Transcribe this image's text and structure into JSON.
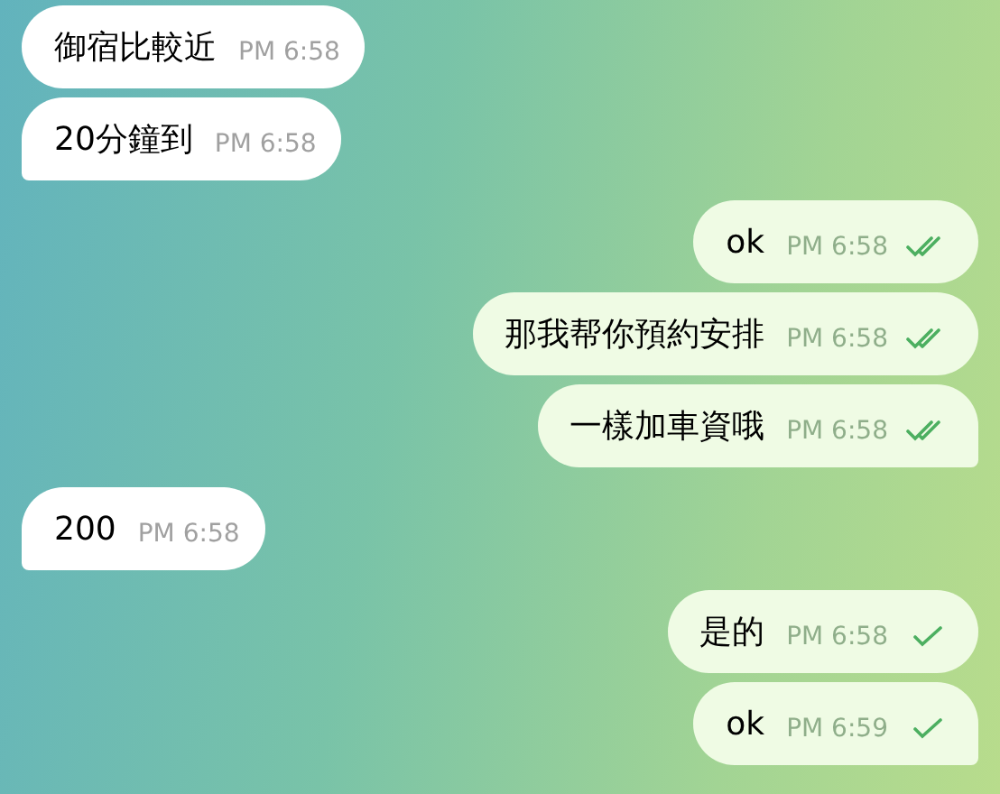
{
  "messages": [
    {
      "kind": "incoming",
      "text": "御宿比較近",
      "time": "PM 6:58"
    },
    {
      "kind": "incoming",
      "text": "20分鐘到",
      "time": "PM 6:58"
    },
    {
      "kind": "outgoing",
      "text": "ok",
      "time": "PM 6:58",
      "read": true
    },
    {
      "kind": "outgoing",
      "text": "那我帮你預約安排",
      "time": "PM 6:58",
      "read": true
    },
    {
      "kind": "outgoing",
      "text": "一樣加車資哦",
      "time": "PM 6:58",
      "read": true
    },
    {
      "kind": "incoming",
      "text": "200",
      "time": "PM 6:58"
    },
    {
      "kind": "outgoing",
      "text": "是的",
      "time": "PM 6:58",
      "read": false
    },
    {
      "kind": "outgoing",
      "text": "ok",
      "time": "PM 6:59",
      "read": false
    }
  ]
}
